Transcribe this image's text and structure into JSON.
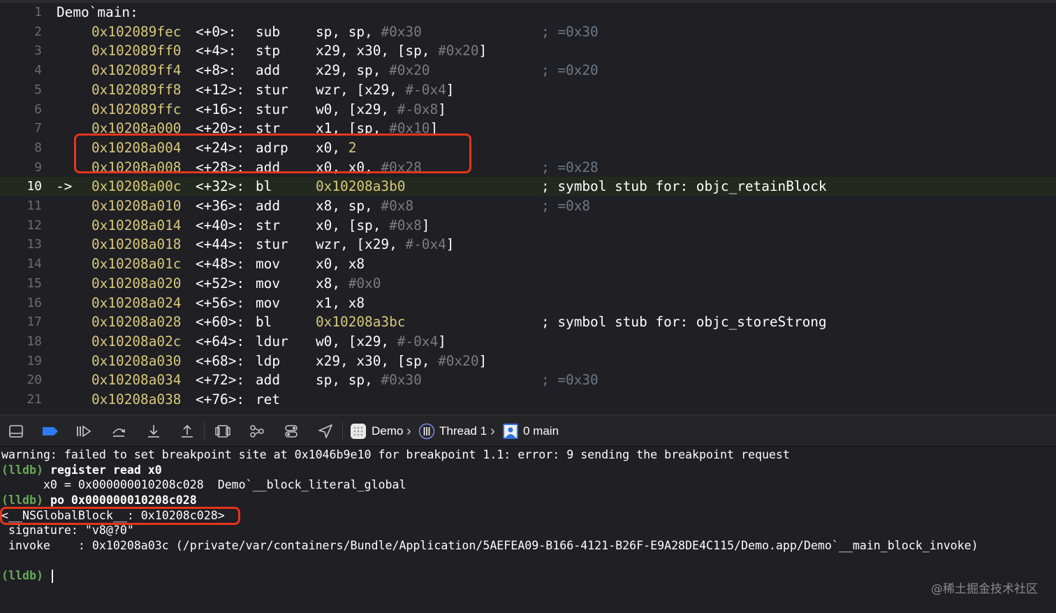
{
  "editor": {
    "title": "Demo`main:",
    "current_line_arrow": "->",
    "lines": [
      {
        "ln": "1"
      },
      {
        "ln": "2",
        "addr": "0x102089fec",
        "off": "<+0>:",
        "op": "sub",
        "a": "sp, sp, ",
        "imm": "#0x30",
        "cmt": "; =0x30"
      },
      {
        "ln": "3",
        "addr": "0x102089ff0",
        "off": "<+4>:",
        "op": "stp",
        "a": "x29, x30, [sp, ",
        "imm": "#0x20",
        "b": "]"
      },
      {
        "ln": "4",
        "addr": "0x102089ff4",
        "off": "<+8>:",
        "op": "add",
        "a": "x29, sp, ",
        "imm": "#0x20",
        "cmt": "; =0x20"
      },
      {
        "ln": "5",
        "addr": "0x102089ff8",
        "off": "<+12>:",
        "op": "stur",
        "a": "wzr, [x29, ",
        "imm": "#-0x4",
        "b": "]"
      },
      {
        "ln": "6",
        "addr": "0x102089ffc",
        "off": "<+16>:",
        "op": "stur",
        "a": "w0, [x29, ",
        "imm": "#-0x8",
        "b": "]"
      },
      {
        "ln": "7",
        "addr": "0x10208a000",
        "off": "<+20>:",
        "op": "str",
        "a": "x1, [sp, ",
        "imm": "#0x10",
        "b": "]"
      },
      {
        "ln": "8",
        "addr": "0x10208a004",
        "off": "<+24>:",
        "op": "adrp",
        "a": "x0, ",
        "num": "2"
      },
      {
        "ln": "9",
        "addr": "0x10208a008",
        "off": "<+28>:",
        "op": "add",
        "a": "x0, x0, ",
        "imm": "#0x28",
        "cmt": "; =0x28"
      },
      {
        "ln": "10",
        "addr": "0x10208a00c",
        "off": "<+32>:",
        "op": "bl",
        "target": "0x10208a3b0",
        "sym": "; symbol stub for: objc_retainBlock"
      },
      {
        "ln": "11",
        "addr": "0x10208a010",
        "off": "<+36>:",
        "op": "add",
        "a": "x8, sp, ",
        "imm": "#0x8",
        "cmt": "; =0x8"
      },
      {
        "ln": "12",
        "addr": "0x10208a014",
        "off": "<+40>:",
        "op": "str",
        "a": "x0, [sp, ",
        "imm": "#0x8",
        "b": "]"
      },
      {
        "ln": "13",
        "addr": "0x10208a018",
        "off": "<+44>:",
        "op": "stur",
        "a": "wzr, [x29, ",
        "imm": "#-0x4",
        "b": "]"
      },
      {
        "ln": "14",
        "addr": "0x10208a01c",
        "off": "<+48>:",
        "op": "mov",
        "a": "x0, x8"
      },
      {
        "ln": "15",
        "addr": "0x10208a020",
        "off": "<+52>:",
        "op": "mov",
        "a": "x8, ",
        "imm": "#0x0"
      },
      {
        "ln": "16",
        "addr": "0x10208a024",
        "off": "<+56>:",
        "op": "mov",
        "a": "x1, x8"
      },
      {
        "ln": "17",
        "addr": "0x10208a028",
        "off": "<+60>:",
        "op": "bl",
        "target": "0x10208a3bc",
        "sym": "; symbol stub for: objc_storeStrong"
      },
      {
        "ln": "18",
        "addr": "0x10208a02c",
        "off": "<+64>:",
        "op": "ldur",
        "a": "w0, [x29, ",
        "imm": "#-0x4",
        "b": "]"
      },
      {
        "ln": "19",
        "addr": "0x10208a030",
        "off": "<+68>:",
        "op": "ldp",
        "a": "x29, x30, [sp, ",
        "imm": "#0x20",
        "b": "]"
      },
      {
        "ln": "20",
        "addr": "0x10208a034",
        "off": "<+72>:",
        "op": "add",
        "a": "sp, sp, ",
        "imm": "#0x30",
        "cmt": "; =0x30"
      },
      {
        "ln": "21",
        "addr": "0x10208a038",
        "off": "<+76>:",
        "op": "ret"
      }
    ]
  },
  "toolbar": {
    "icons": [
      "hide-console-icon",
      "breakpoints-toggle-icon",
      "continue-icon",
      "step-over-icon",
      "step-into-icon",
      "step-out-icon",
      "view-hierarchy-icon",
      "memory-graph-icon",
      "environment-overrides-icon",
      "simulate-location-icon"
    ],
    "breadcrumbs": {
      "app": "Demo",
      "thread": "Thread 1",
      "frame": "0 main"
    },
    "accent": "#2f7bf6"
  },
  "console": {
    "warning": "warning: failed to set breakpoint site at 0x1046b9e10 for breakpoint 1.1: error: 9 sending the breakpoint request",
    "prompt": "(lldb)",
    "cmd1": "register read x0",
    "out1": "      x0 = 0x000000010208c028  Demo`__block_literal_global",
    "cmd2": "po 0x000000010208c028",
    "out2": "<__NSGlobalBlock__: 0x10208c028>",
    "out3": " signature: \"v8@?0\"",
    "out4": " invoke    : 0x10208a03c (/private/var/containers/Bundle/Application/5AEFEA09-B166-4121-B26F-E9A28DE4C115/Demo.app/Demo`__main_block_invoke)"
  },
  "watermark": "@稀土掘金技术社区",
  "colors": {
    "highlight_box": "#e5351b",
    "prompt": "#68a957",
    "address": "#d9c97c",
    "comment": "#6c7986"
  }
}
